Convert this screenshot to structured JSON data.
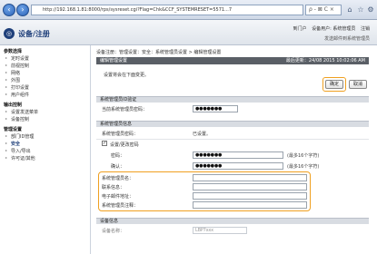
{
  "browser": {
    "back_icon": "back-arrow-icon",
    "forward_icon": "forward-arrow-icon",
    "url": "http://192.168.1.81:8000/rps/sysreset.cgi?Flag=Chk&CCF_SYSTEMRESET=5571...7",
    "search_label": "ρ - ⊠ C ×"
  },
  "header": {
    "title": "设备/注册",
    "links": [
      "到门户",
      "设备用户: 系统管理员",
      "注销"
    ],
    "sub_link": "发送邮件到系统管理员"
  },
  "sidebar": {
    "sections": [
      {
        "label": "参数选择",
        "items": [
          "定时设置",
          "前视控制",
          "网络",
          "外围",
          "打印设置",
          "用户组件"
        ]
      },
      {
        "label": "输出控制",
        "items": [
          "设置发送菜单",
          "设备控制"
        ]
      },
      {
        "label": "管理设置",
        "items": [
          "部门ID管理",
          "安全",
          "导入/导出",
          "许可证/其他"
        ]
      }
    ],
    "active_item": "安全"
  },
  "main": {
    "breadcrumb": "设备注册：管理设置：安全：系统管理员设置 > 编辑管理设置",
    "page_title": "编辑管理设置",
    "last_updated": "最后更新：24/08 2015 10:02:06 AM",
    "notice": "设置将会在下面变更。",
    "ok_label": "确定",
    "cancel_label": "取消",
    "section_admin_id": {
      "title": "系统管理员ID验证",
      "password_label": "当前系统管理员密码：",
      "password_value": "●●●●●●●"
    },
    "section_admin_info": {
      "title": "系统管理员信息",
      "pin_label": "系统管理员密码：",
      "pin_status": "已设置。",
      "change_password_label": "设置/更改密码",
      "checkbox_mark": "✓",
      "password_label": "密码：",
      "password_value": "●●●●●●●",
      "password_hint": "(最多16个字符)",
      "confirm_label": "确认：",
      "confirm_value": "●●●●●●●",
      "confirm_hint": "(最多16个字符)",
      "name_label": "系统管理员名：",
      "contact_label": "联系信息：",
      "email_label": "电子邮件地址：",
      "comment_label": "系统管理员注释："
    },
    "section_device": {
      "title": "设备信息",
      "name_label": "设备名称：",
      "name_value": "LBP7xxx"
    }
  }
}
